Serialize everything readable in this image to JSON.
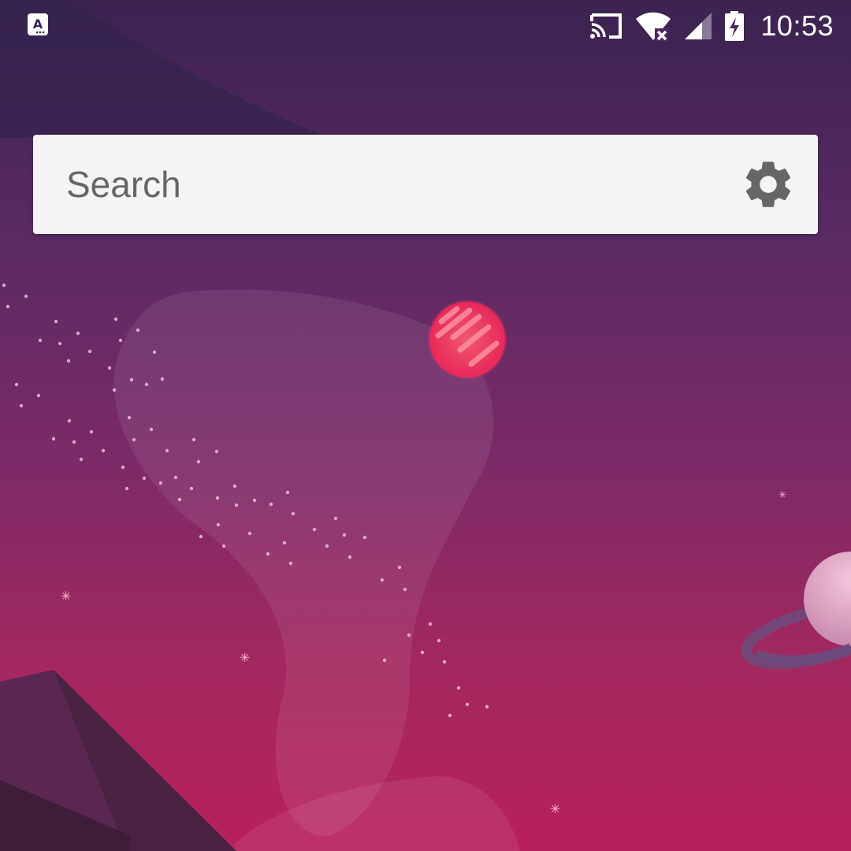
{
  "status_bar": {
    "time": "10:53",
    "notification_icon": "accessibility-a-icon",
    "icons": [
      "cast-icon",
      "wifi-no-internet-icon",
      "cell-signal-icon",
      "battery-charging-icon"
    ]
  },
  "search": {
    "placeholder": "Search",
    "value": "",
    "settings_icon": "gear-icon"
  },
  "colors": {
    "background_top": "#3b2350",
    "background_bottom": "#b8205c",
    "search_bg": "#f4f4f4",
    "icon_gray": "#666666",
    "planet_red": "#e8345a"
  }
}
